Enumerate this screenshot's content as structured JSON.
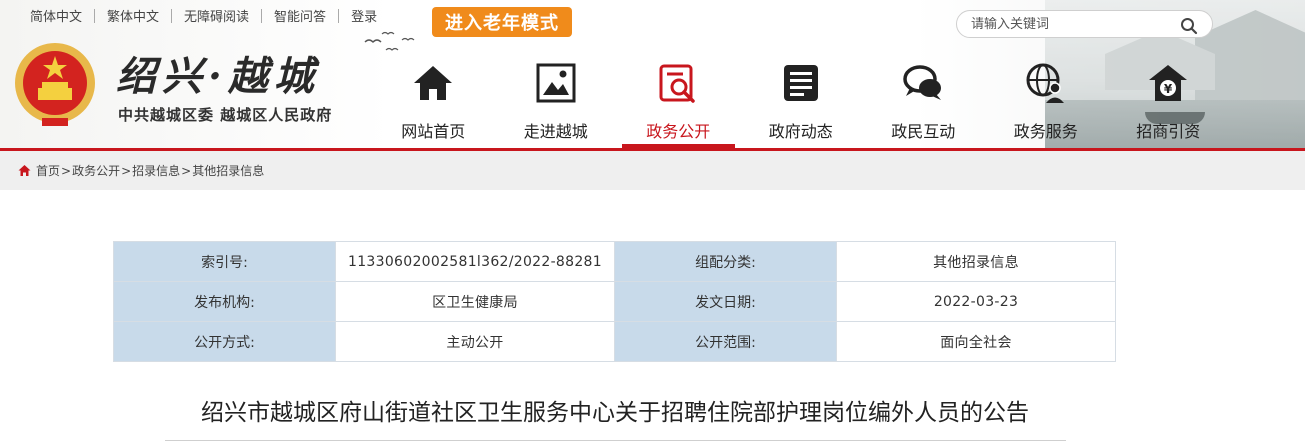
{
  "top_links": [
    "简体中文",
    "繁体中文",
    "无障碍阅读",
    "智能问答",
    "登录"
  ],
  "elder_mode_label": "进入老年模式",
  "search": {
    "placeholder": "请输入关键词"
  },
  "logo": {
    "title": "绍兴·越城",
    "subtitle": "中共越城区委 越城区人民政府"
  },
  "nav": [
    {
      "label": "网站首页",
      "icon": "home-icon"
    },
    {
      "label": "走进越城",
      "icon": "picture-icon"
    },
    {
      "label": "政务公开",
      "icon": "search-document-icon",
      "active": true
    },
    {
      "label": "政府动态",
      "icon": "news-icon"
    },
    {
      "label": "政民互动",
      "icon": "chat-icon"
    },
    {
      "label": "政务服务",
      "icon": "globe-user-icon"
    },
    {
      "label": "招商引资",
      "icon": "yuan-house-icon"
    }
  ],
  "breadcrumb": [
    "首页",
    "政务公开",
    "招录信息",
    "其他招录信息"
  ],
  "meta_table": [
    [
      {
        "key": "索引号:",
        "value": "11330602002581l362/2022-88281"
      },
      {
        "key": "组配分类:",
        "value": "其他招录信息"
      }
    ],
    [
      {
        "key": "发布机构:",
        "value": "区卫生健康局"
      },
      {
        "key": "发文日期:",
        "value": "2022-03-23"
      }
    ],
    [
      {
        "key": "公开方式:",
        "value": "主动公开"
      },
      {
        "key": "公开范围:",
        "value": "面向全社会"
      }
    ]
  ],
  "article_title": "绍兴市越城区府山街道社区卫生服务中心关于招聘住院部护理岗位编外人员的公告",
  "colors": {
    "accent": "#c8161d",
    "elder_button": "#f08b1b",
    "table_key_bg": "#c8daea"
  }
}
